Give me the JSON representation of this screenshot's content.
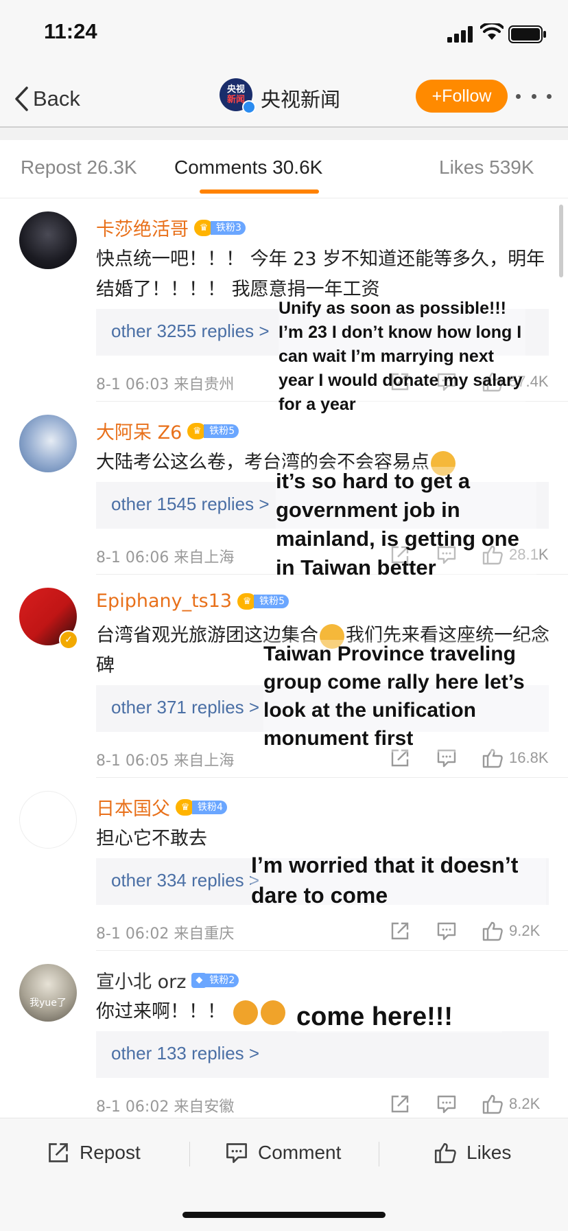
{
  "status_bar": {
    "time": "11:24"
  },
  "nav": {
    "back_label": "Back",
    "account_name": "央视新闻",
    "avatar_text_top": "央视",
    "avatar_text_bottom": "新闻",
    "follow_label": "+Follow"
  },
  "tabs": [
    {
      "label": "Repost 26.3K",
      "active": false
    },
    {
      "label": "Comments 30.6K",
      "active": true
    },
    {
      "label": "Likes 539K",
      "active": false
    }
  ],
  "comments": [
    {
      "username": "卡莎绝活哥",
      "fan_badge": "铁粉3",
      "text": "快点统一吧！！！ 今年 23 岁不知道还能等多久，明年结婚了！！！！ 我愿意捐一年工资",
      "replies": "other 3255 replies >",
      "time_location": "8-1 06:03  来自贵州",
      "likes": "57.4K",
      "caption": "Unify as soon as possible!!! I’m 23 I don’t know how long I can wait I’m marrying next year I would donate my salary for a year"
    },
    {
      "username": "大阿呆 Z6",
      "fan_badge": "铁粉5",
      "text": "大陆考公这么卷，考台湾的会不会容易点",
      "replies": "other 1545 replies >",
      "time_location": "8-1 06:06  来自上海",
      "likes": "28.1K",
      "caption": "it’s so hard to get a government job in mainland, is getting one in Taiwan better"
    },
    {
      "username": "Epiphany_ts13",
      "fan_badge": "铁粉5",
      "text": "台湾省观光旅游团这边集合",
      "text_after_emoji": "我们先来看这座统一纪念碑",
      "replies": "other 371 replies >",
      "time_location": "8-1 06:05  来自上海",
      "likes": "16.8K",
      "caption": "Taiwan Province traveling group come rally here let’s look at the unification monument first"
    },
    {
      "username": "日本国父",
      "fan_badge": "铁粉4",
      "text": "担心它不敢去",
      "replies": "other 334 replies >",
      "time_location": "8-1 06:02  来自重庆",
      "likes": "9.2K",
      "caption": "I’m worried that it doesn’t dare to come"
    },
    {
      "username": "宣小北 orz",
      "fan_badge": "铁粉2",
      "avatar_text": "我yue了",
      "text": "你过来啊！！！",
      "replies": "other 133 replies >",
      "time_location": "8-1 06:02  来自安徽",
      "likes": "8.2K",
      "caption": "come here!!!"
    }
  ],
  "bottom_bar": {
    "repost_label": "Repost",
    "comment_label": "Comment",
    "likes_label": "Likes"
  },
  "colors": {
    "accent_orange": "#ff8200",
    "username_orange": "#e8701a",
    "link_blue": "#4a6fa5",
    "fan_badge_blue": "#6aa6ff"
  }
}
